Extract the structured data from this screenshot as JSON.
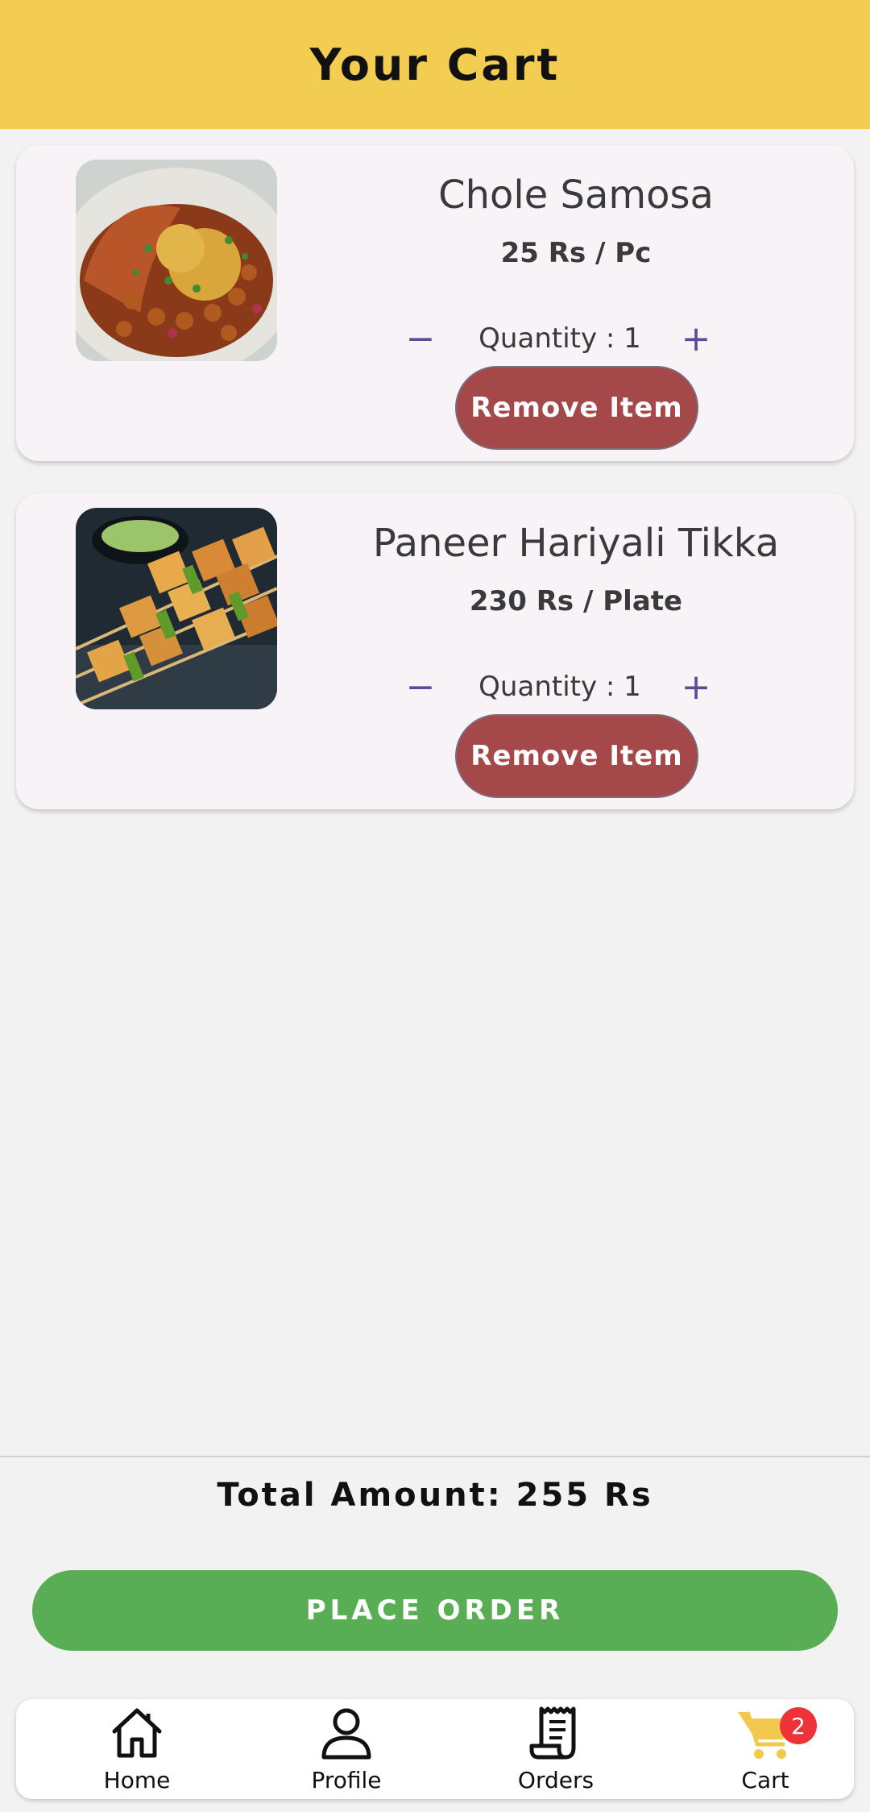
{
  "header": {
    "title": "Your Cart"
  },
  "cart": {
    "items": [
      {
        "name": "Chole Samosa",
        "price": "25 Rs / Pc",
        "quantity_text": "Quantity : 1",
        "minus": "−",
        "plus": "+",
        "remove_label": "Remove Item"
      },
      {
        "name": "Paneer Hariyali Tikka",
        "price": "230 Rs / Plate",
        "quantity_text": "Quantity : 1",
        "minus": "−",
        "plus": "+",
        "remove_label": "Remove Item"
      }
    ]
  },
  "summary": {
    "total_text": "Total Amount: 255 Rs"
  },
  "actions": {
    "place_order_label": "PLACE ORDER"
  },
  "nav": {
    "items": [
      {
        "label": "Home",
        "icon": "home-icon"
      },
      {
        "label": "Profile",
        "icon": "person-icon"
      },
      {
        "label": "Orders",
        "icon": "receipt-icon"
      },
      {
        "label": "Cart",
        "icon": "cart-icon",
        "badge": "2"
      }
    ]
  },
  "colors": {
    "header_bg": "#f2cd52",
    "remove_button": "#a4484a",
    "place_order": "#59ae55",
    "badge": "#ec3338",
    "qty_accent": "#5a4b9b",
    "cart_active": "#f2c94c"
  }
}
